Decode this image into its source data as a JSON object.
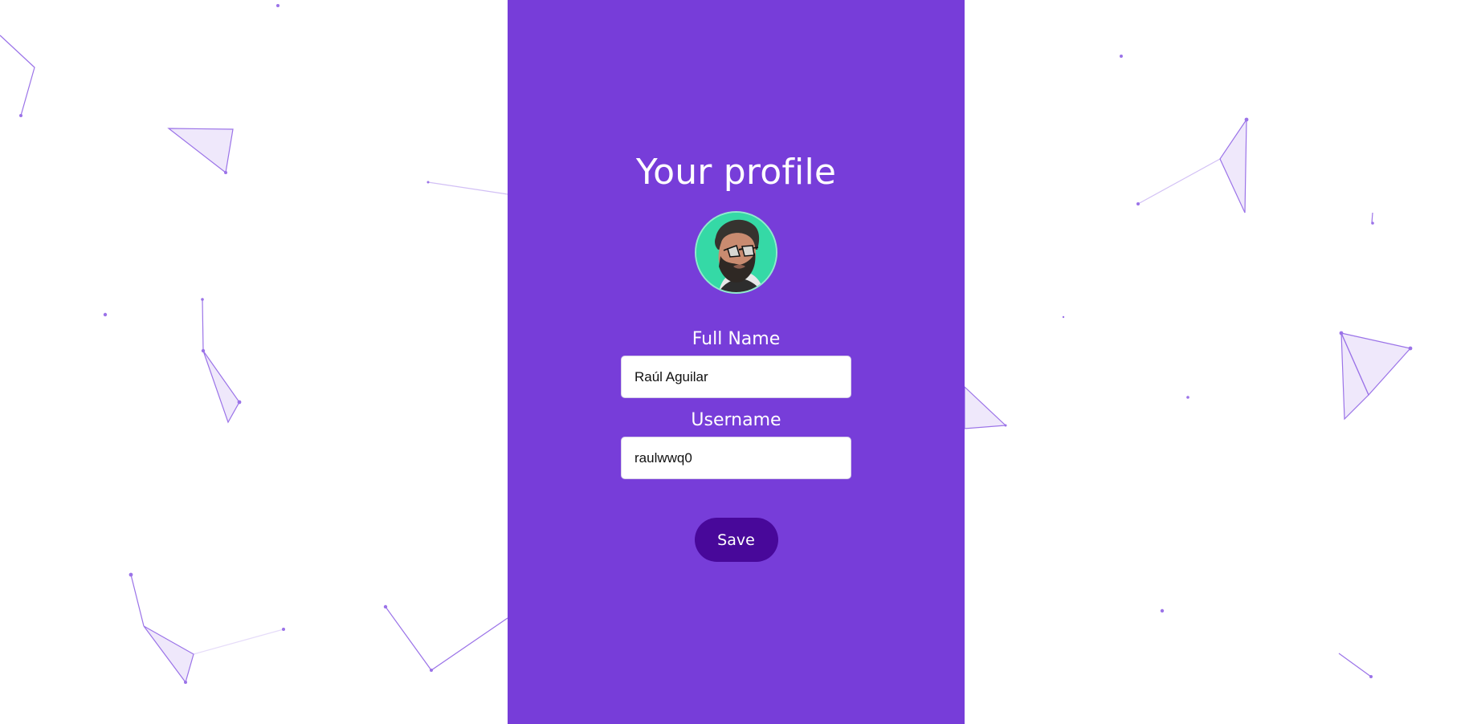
{
  "profile": {
    "title": "Your profile",
    "avatar_alt": "profile avatar",
    "full_name": {
      "label": "Full Name",
      "value": "Raúl Aguilar"
    },
    "username": {
      "label": "Username",
      "value": "raulwwq0"
    },
    "save_label": "Save"
  },
  "colors": {
    "panel": "#773dd9",
    "button": "#48089a",
    "avatar_background": "#35d9a6",
    "network_lines": "#9b73e8"
  }
}
